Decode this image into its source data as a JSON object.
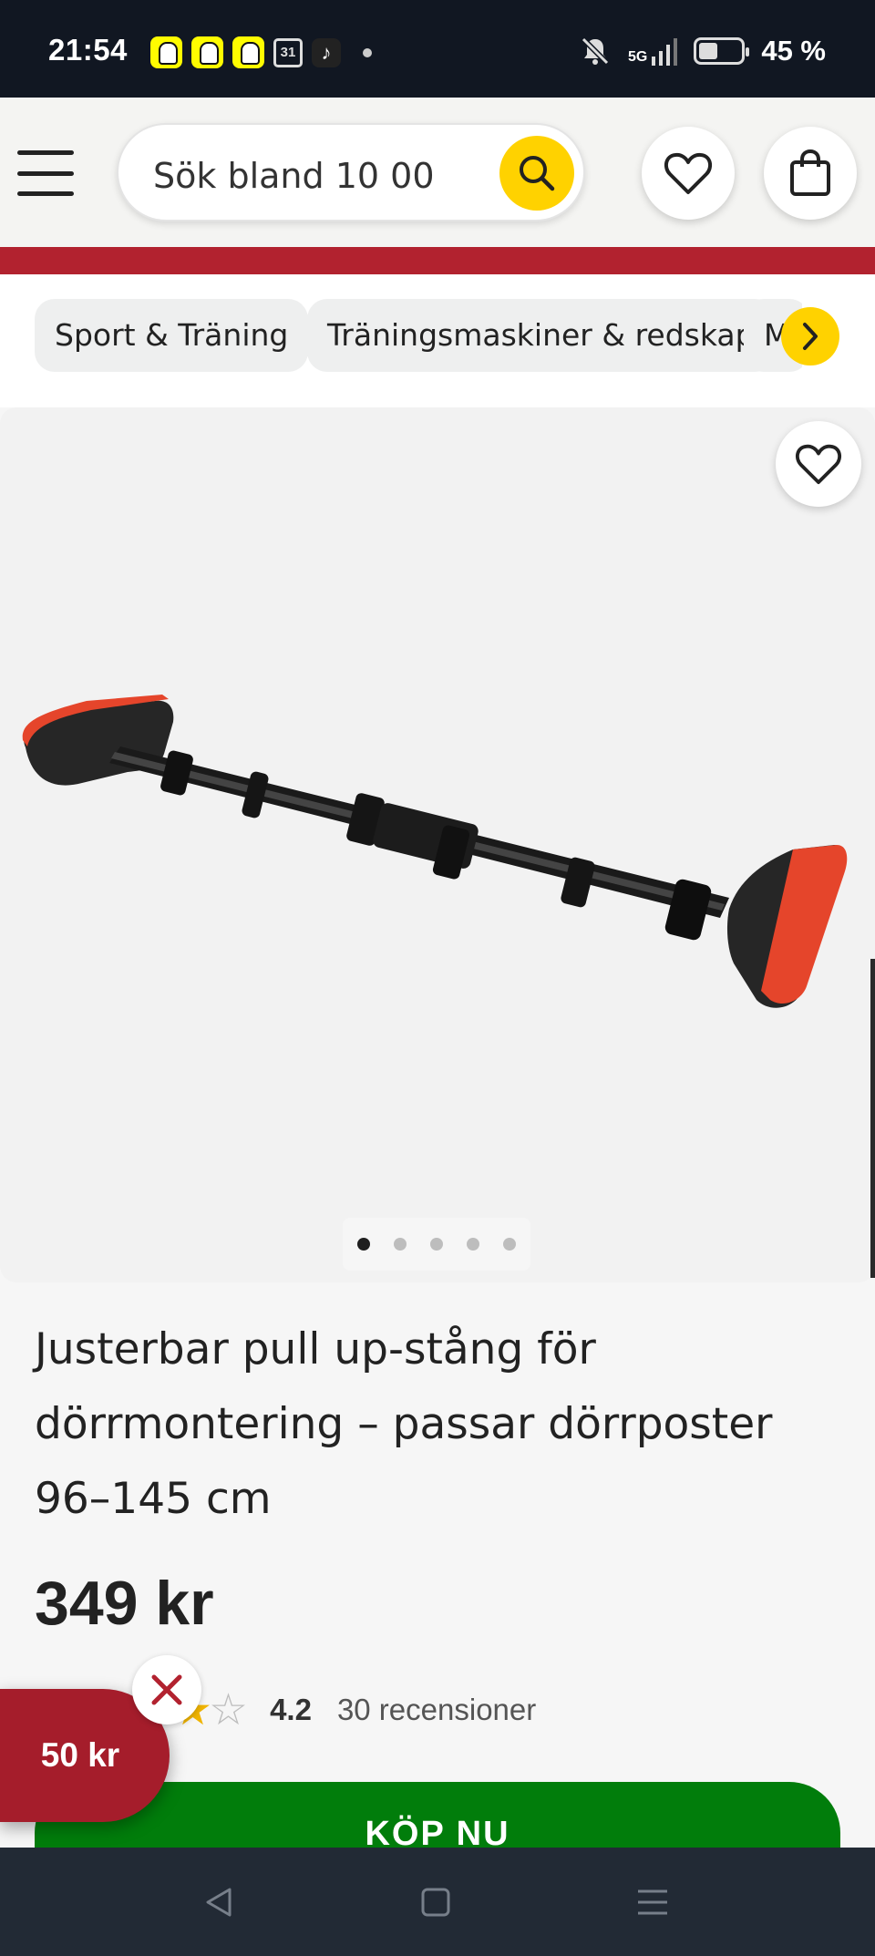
{
  "status_bar": {
    "time": "21:54",
    "calendar_day": "31",
    "network": "5G",
    "battery": "45 %",
    "icons": [
      "snapchat-icon",
      "snapchat-icon",
      "snapchat-icon",
      "calendar-icon",
      "tiktok-icon",
      "mute-icon",
      "signal-icon",
      "battery-icon"
    ]
  },
  "header": {
    "search": {
      "placeholder": "Sök bland 10 00"
    },
    "icons": [
      "menu-icon",
      "search-icon",
      "heart-icon",
      "bag-icon"
    ]
  },
  "categories": {
    "chips": [
      "Sport & Träning",
      "Träningsmaskiner & redskap",
      "M"
    ],
    "next_icon": "chevron-right-icon"
  },
  "product": {
    "image_alt": "pull-up-bar",
    "image_count": 5,
    "active_image": 1,
    "title": "Justerbar pull up-stång för dörrmontering – passar dörrposter 96–145 cm",
    "price": "349 kr",
    "rating": {
      "value": "4.2",
      "stars": "★★☆",
      "reviews": "30 recensioner"
    },
    "buy_label": "KÖP NU"
  },
  "promo": {
    "label": "50 kr",
    "close_icon": "close-icon"
  },
  "colors": {
    "accent_yellow": "#ffd200",
    "brand_red": "#b2222f",
    "buy_green": "#017d0b",
    "status_bar": "#111722"
  }
}
